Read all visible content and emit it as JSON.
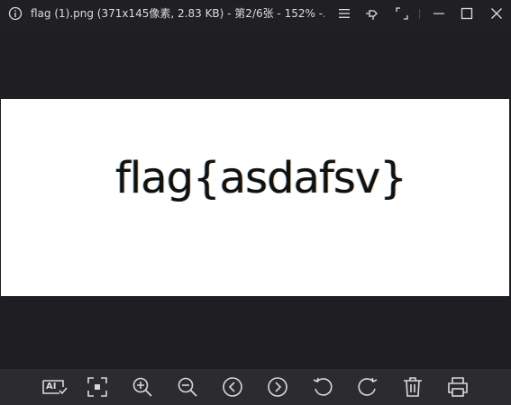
{
  "titlebar": {
    "title": "flag (1).png (371x145像素, 2.83 KB) - 第2/6张 - 152% -..."
  },
  "image": {
    "text": "flag{asdafsv}"
  },
  "icons": {
    "info": "info-icon",
    "menu": "menu-icon",
    "pin": "pin-icon",
    "fullscreen": "fullscreen-icon",
    "minimize": "minimize-icon",
    "maximize": "maximize-icon",
    "close": "close-icon",
    "ocr": "ai-ocr-icon",
    "fit": "fit-to-window-icon",
    "zoom_in": "zoom-in-icon",
    "zoom_out": "zoom-out-icon",
    "previous": "previous-icon",
    "next": "next-icon",
    "rotate_left": "rotate-left-icon",
    "rotate_right": "rotate-right-icon",
    "delete": "delete-icon",
    "print": "print-icon"
  },
  "toolbar": {
    "ocr_label": "AI"
  },
  "colors": {
    "background": "#1f1f23",
    "toolbar": "#2c2c30",
    "icon": "#d8d8d8"
  }
}
